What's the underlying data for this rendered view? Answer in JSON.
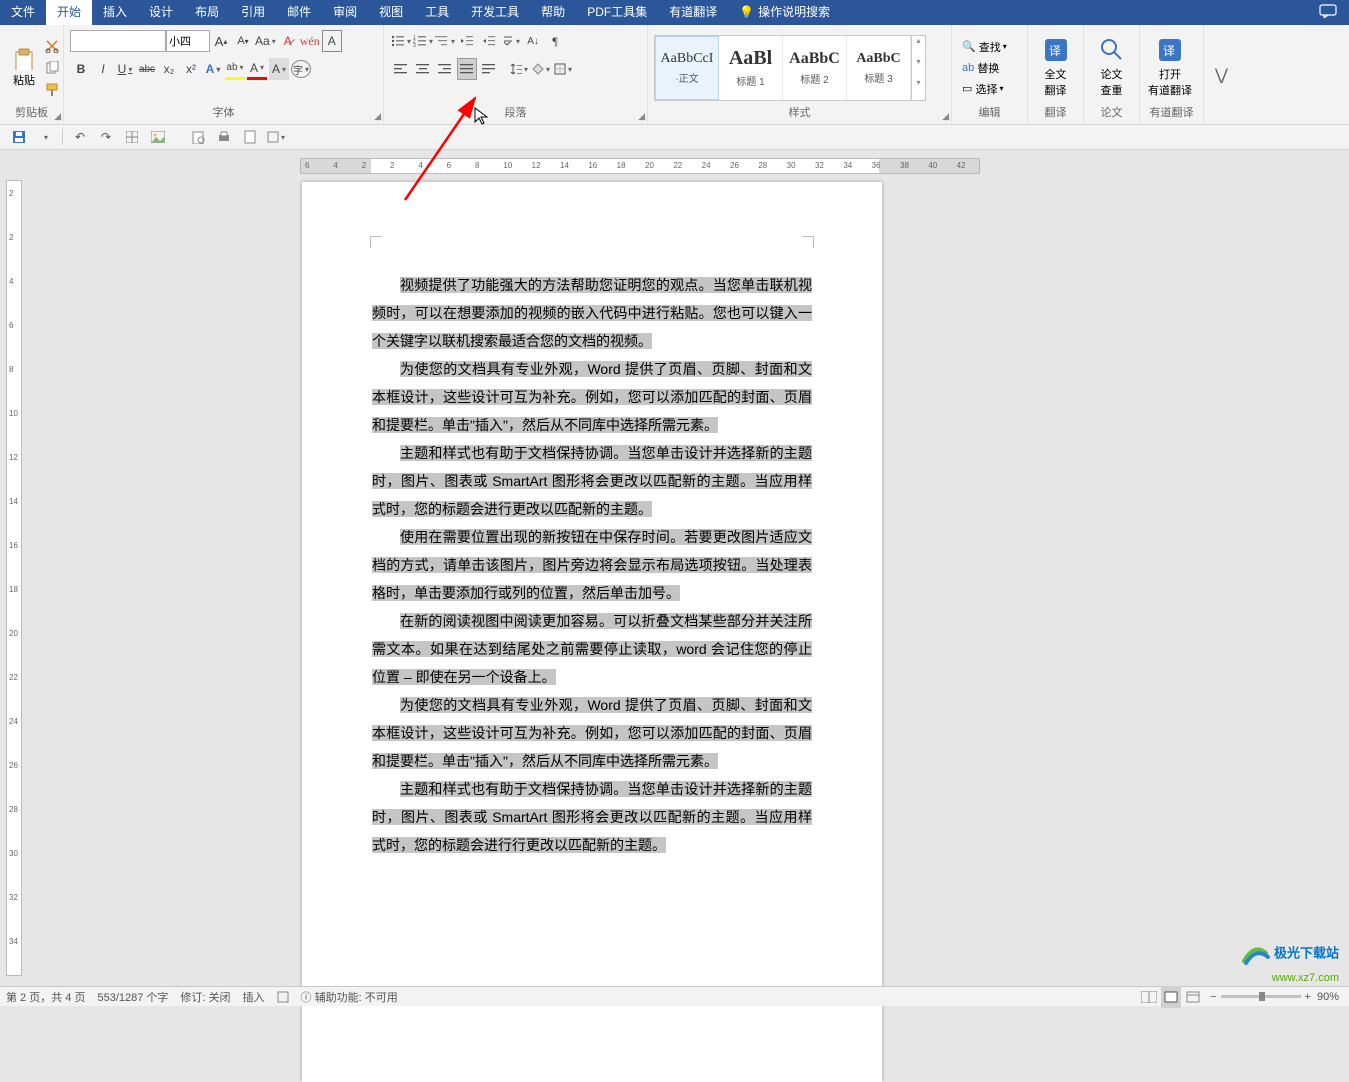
{
  "menubar": {
    "tabs": [
      "文件",
      "开始",
      "插入",
      "设计",
      "布局",
      "引用",
      "邮件",
      "审阅",
      "视图",
      "工具",
      "开发工具",
      "帮助",
      "PDF工具集",
      "有道翻译"
    ],
    "active_index": 1,
    "search_hint": "操作说明搜索"
  },
  "ribbon": {
    "clipboard": {
      "paste": "粘贴",
      "label": "剪贴板"
    },
    "font": {
      "name_value": "",
      "size_value": "小四",
      "label": "字体",
      "buttons": {
        "bold": "B",
        "italic": "I",
        "underline": "U",
        "strike": "abc",
        "sub": "x₂",
        "sup": "x²",
        "case": "Aa",
        "clear": "A",
        "phonetic": "⺀",
        "charborder": "A",
        "fontcolor": "A",
        "highlight": "ab",
        "shading": "A",
        "grow": "A",
        "shrink": "A",
        "enclose": "字"
      }
    },
    "paragraph": {
      "label": "段落"
    },
    "styles": {
      "label": "样式",
      "items": [
        {
          "preview": "AaBbCcI",
          "name": "·正文",
          "previewSize": "14px"
        },
        {
          "preview": "AaBl",
          "name": "标题 1",
          "previewSize": "20px"
        },
        {
          "preview": "AaBbC",
          "name": "标题 2",
          "previewSize": "16px"
        },
        {
          "preview": "AaBbC",
          "name": "标题 3",
          "previewSize": "14px"
        }
      ]
    },
    "editing": {
      "label": "编辑",
      "find": "查找",
      "replace": "替换",
      "select": "选择"
    },
    "translate": {
      "label": "翻译",
      "full": "全文",
      "fl2": "翻译"
    },
    "thesis": {
      "label": "论文",
      "check": "论文",
      "cl2": "查重"
    },
    "youdao": {
      "label": "有道翻译",
      "open": "打开",
      "ol2": "有道翻译"
    }
  },
  "qat": {
    "ruler_label": "L"
  },
  "hruler": {
    "ticks": [
      "6",
      "4",
      "2",
      "2",
      "4",
      "6",
      "8",
      "10",
      "12",
      "14",
      "16",
      "18",
      "20",
      "22",
      "24",
      "26",
      "28",
      "30",
      "32",
      "34",
      "36",
      "38",
      "40",
      "42"
    ]
  },
  "vruler": {
    "ticks": [
      "2",
      "2",
      "4",
      "6",
      "8",
      "10",
      "12",
      "14",
      "16",
      "18",
      "20",
      "22",
      "24",
      "26",
      "28",
      "30",
      "32",
      "34"
    ]
  },
  "document": {
    "paragraphs": [
      "视频提供了功能强大的方法帮助您证明您的观点。当您单击联机视频时，可以在想要添加的视频的嵌入代码中进行粘贴。您也可以键入一个关键字以联机搜索最适合您的文档的视频。",
      "为使您的文档具有专业外观，Word 提供了页眉、页脚、封面和文本框设计，这些设计可互为补充。例如，您可以添加匹配的封面、页眉和提要栏。单击\"插入\"，然后从不同库中选择所需元素。",
      "主题和样式也有助于文档保持协调。当您单击设计并选择新的主题时，图片、图表或 SmartArt 图形将会更改以匹配新的主题。当应用样式时，您的标题会进行更改以匹配新的主题。",
      "使用在需要位置出现的新按钮在中保存时间。若要更改图片适应文档的方式，请单击该图片，图片旁边将会显示布局选项按钮。当处理表格时，单击要添加行或列的位置，然后单击加号。",
      "在新的阅读视图中阅读更加容易。可以折叠文档某些部分并关注所需文本。如果在达到结尾处之前需要停止读取，word 会记住您的停止位置 – 即使在另一个设备上。",
      "为使您的文档具有专业外观，Word 提供了页眉、页脚、封面和文本框设计，这些设计可互为补充。例如，您可以添加匹配的封面、页眉和提要栏。单击\"插入\"，然后从不同库中选择所需元素。",
      "主题和样式也有助于文档保持协调。当您单击设计并选择新的主题时，图片、图表或 SmartArt 图形将会更改以匹配新的主题。当应用样式时，您的标题会进行行更改以匹配新的主题。"
    ]
  },
  "statusbar": {
    "page": "第 2 页，共 4 页",
    "words": "553/1287 个字",
    "revision": "修订: 关闭",
    "insert": "插入",
    "accessibility": "辅助功能: 不可用",
    "zoom": "90%"
  },
  "watermark": {
    "line1": "极光下载站",
    "line2": "www.xz7.com"
  }
}
